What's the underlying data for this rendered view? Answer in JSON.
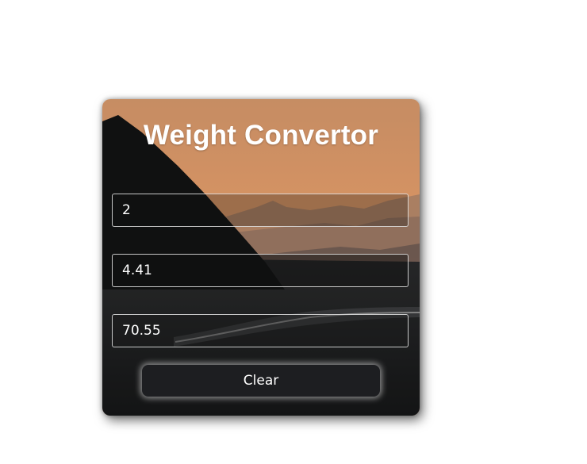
{
  "app": {
    "title": "Weight Convertor"
  },
  "inputs": {
    "kilograms": {
      "value": "2"
    },
    "pounds": {
      "value": "4.41"
    },
    "ounces": {
      "value": "70.55"
    }
  },
  "actions": {
    "clear_label": "Clear"
  },
  "colors": {
    "sky": "#e8a06c",
    "mountain": "#121313",
    "button": "#1d1e21",
    "text": "#ffffff"
  }
}
